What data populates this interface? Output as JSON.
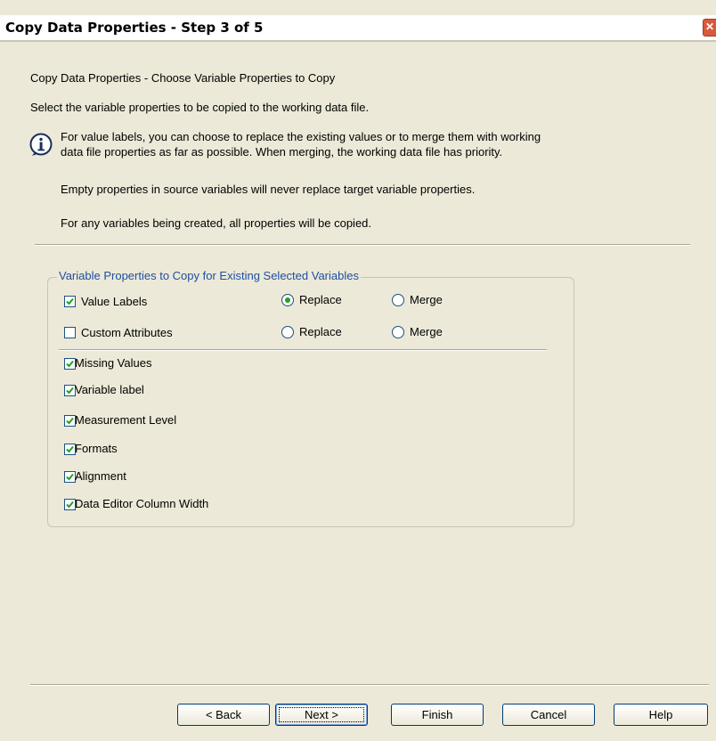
{
  "window": {
    "title": "Copy Data Properties - Step 3 of 5",
    "close_glyph": "✕"
  },
  "header": {
    "heading": "Copy Data Properties - Choose Variable Properties to Copy",
    "instruction": "Select the variable properties to be copied to the working data file.",
    "info_icon": "info-icon",
    "info_line1": "For value labels, you can choose to replace the existing values or to merge them with working",
    "info_line2": "data file properties as far as possible.  When merging, the working data file has priority.",
    "note1": "Empty properties in source variables will never replace target variable properties.",
    "note2": "For any variables being created, all properties will be copied."
  },
  "group": {
    "title": "Variable Properties to Copy for Existing Selected Variables",
    "value_labels": {
      "label": "Value Labels",
      "checked": true,
      "replace_label": "Replace",
      "merge_label": "Merge",
      "selected": "Replace"
    },
    "custom_attributes": {
      "label": "Custom Attributes",
      "checked": false,
      "replace_label": "Replace",
      "merge_label": "Merge",
      "selected": ""
    },
    "items": [
      {
        "label": "Missing Values",
        "checked": true
      },
      {
        "label": "Variable label",
        "checked": true
      },
      {
        "label": "Measurement Level",
        "checked": true
      },
      {
        "label": "Formats",
        "checked": true
      },
      {
        "label": "Alignment",
        "checked": true
      },
      {
        "label": "Data Editor Column Width",
        "checked": true
      }
    ]
  },
  "buttons": {
    "back": "< Back",
    "next": "Next >",
    "finish": "Finish",
    "cancel": "Cancel",
    "help": "Help"
  },
  "colors": {
    "dialog_bg": "#ece9d8",
    "group_title": "#1e4fa0",
    "check": "#21a121"
  }
}
